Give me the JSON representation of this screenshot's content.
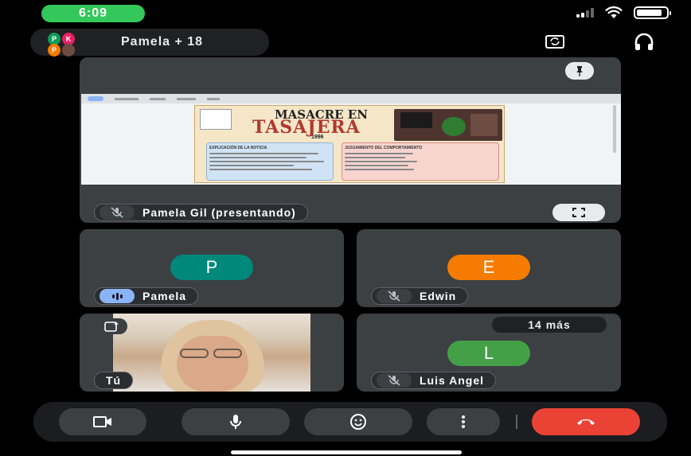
{
  "status": {
    "time": "6:09"
  },
  "header": {
    "title": "Pamela + 18",
    "avatars": [
      {
        "letter": "P",
        "color": "#0f9d58"
      },
      {
        "letter": "K",
        "color": "#e91e63"
      },
      {
        "letter": "P",
        "color": "#f57c00"
      }
    ]
  },
  "presenter_tile": {
    "name": "Pamela Gil (presentando)",
    "shared_doc": {
      "title_line1": "MASACRE EN",
      "title_line2": "TASAJERA",
      "year": "1996",
      "left_heading": "EXPLICACIÓN DE LA NOTICIA",
      "right_heading": "JUZGAMIENTO DEL COMPORTAMIENTO"
    }
  },
  "participants": {
    "pamela": {
      "name": "Pamela",
      "initial": "P",
      "color": "#00897b"
    },
    "edwin": {
      "name": "Edwin",
      "initial": "E",
      "color": "#f57c00"
    },
    "self": {
      "name": "Tú"
    },
    "luis": {
      "name": "Luis Angel",
      "initial": "L",
      "color": "#43a047",
      "more": "14 más"
    }
  }
}
